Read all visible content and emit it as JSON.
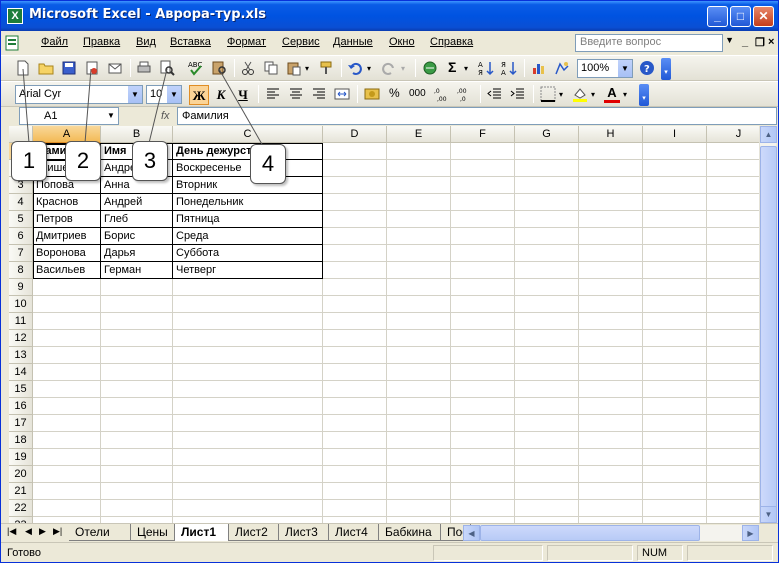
{
  "window": {
    "title": "Microsoft Excel - Аврора-тур.xls",
    "controls": {
      "minimize": "_",
      "maximize": "□",
      "close": "✕"
    }
  },
  "menu": {
    "items": [
      "Файл",
      "Правка",
      "Вид",
      "Вставка",
      "Формат",
      "Сервис",
      "Данные",
      "Окно",
      "Справка"
    ],
    "help_placeholder": "Введите вопрос",
    "doc_controls": {
      "minimize": "_",
      "restore": "❐",
      "close": "×"
    }
  },
  "toolbar": {
    "zoom": "100%",
    "font_name": "Arial Cyr",
    "font_size": "10",
    "bold_label": "Ж",
    "italic_label": "К",
    "underline_label": "Ч",
    "percent_label": "%",
    "thousands_label": "000",
    "sum_label": "Σ",
    "font_color_label": "A"
  },
  "formula_bar": {
    "name_box": "A1",
    "fx": "fx",
    "content": "Фамилия"
  },
  "columns": [
    "A",
    "B",
    "C",
    "D",
    "E",
    "F",
    "G",
    "H",
    "I",
    "J"
  ],
  "rows": [
    "1",
    "2",
    "3",
    "4",
    "5",
    "6",
    "7",
    "8",
    "9",
    "10",
    "11",
    "12",
    "13",
    "14",
    "15",
    "16",
    "17",
    "18",
    "19",
    "20",
    "21",
    "22",
    "23"
  ],
  "table": {
    "header": [
      "Фамилия",
      "Имя",
      "День дежурства"
    ],
    "data": [
      [
        "Агишева",
        "Андрей",
        "Воскресенье"
      ],
      [
        "Попова",
        "Анна",
        "Вторник"
      ],
      [
        "Краснов",
        "Андрей",
        "Понедельник"
      ],
      [
        "Петров",
        "Глеб",
        "Пятница"
      ],
      [
        "Дмитриев",
        "Борис",
        "Среда"
      ],
      [
        "Воронова",
        "Дарья",
        "Суббота"
      ],
      [
        "Васильев",
        "Герман",
        "Четверг"
      ]
    ]
  },
  "sheet_tabs": [
    "Отели",
    "Цены",
    "Лист1",
    "Лист2",
    "Лист3",
    "Лист4",
    "Бабкина",
    "Пос"
  ],
  "active_sheet": "Лист1",
  "status": {
    "text": "Готово",
    "num": "NUM"
  },
  "callouts": [
    "1",
    "2",
    "3",
    "4"
  ],
  "colors": {
    "title_bar": "#0053e1",
    "selected_header": "#f3b955",
    "gridline": "#d4d2c7"
  }
}
